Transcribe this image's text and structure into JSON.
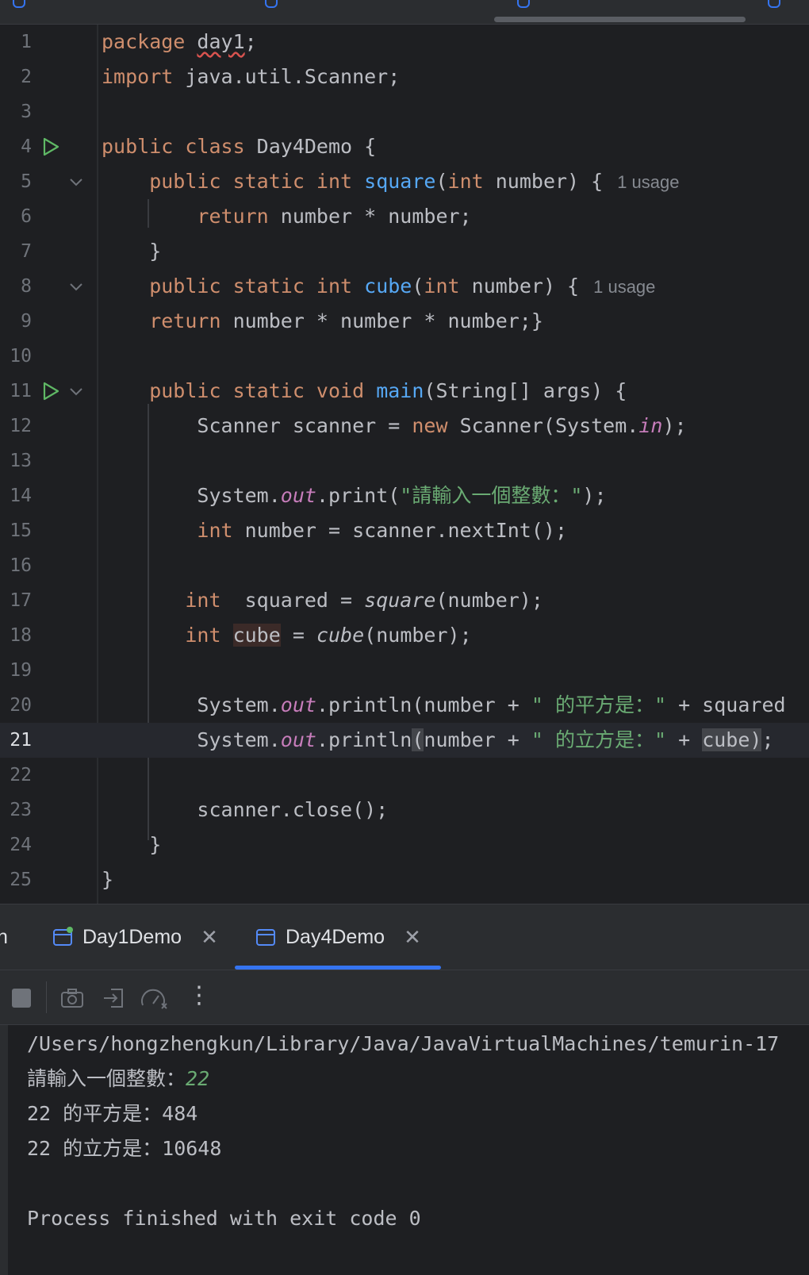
{
  "editor": {
    "lines": [
      {
        "num": "1",
        "tokens": [
          {
            "t": "package ",
            "c": "kw"
          },
          {
            "t": "day1",
            "c": "squiggle"
          },
          {
            "t": ";",
            "c": ""
          }
        ]
      },
      {
        "num": "2",
        "tokens": [
          {
            "t": "import ",
            "c": "kw"
          },
          {
            "t": "java.util.Scanner;",
            "c": ""
          }
        ]
      },
      {
        "num": "3",
        "tokens": []
      },
      {
        "num": "4",
        "tokens": [
          {
            "t": "public class ",
            "c": "kw"
          },
          {
            "t": "Day4Demo {",
            "c": ""
          }
        ]
      },
      {
        "num": "5",
        "tokens": [
          {
            "t": "    public static int ",
            "c": "kw"
          },
          {
            "t": "square",
            "c": "fn"
          },
          {
            "t": "(",
            "c": ""
          },
          {
            "t": "int ",
            "c": "kw"
          },
          {
            "t": "number) {",
            "c": ""
          },
          {
            "t": "1 usage",
            "c": "hint"
          }
        ]
      },
      {
        "num": "6",
        "tokens": [
          {
            "t": "        return ",
            "c": "kw"
          },
          {
            "t": "number * number;",
            "c": ""
          }
        ]
      },
      {
        "num": "7",
        "tokens": [
          {
            "t": "    }",
            "c": ""
          }
        ]
      },
      {
        "num": "8",
        "tokens": [
          {
            "t": "    public static int ",
            "c": "kw"
          },
          {
            "t": "cube",
            "c": "fn"
          },
          {
            "t": "(",
            "c": ""
          },
          {
            "t": "int ",
            "c": "kw"
          },
          {
            "t": "number) {",
            "c": ""
          },
          {
            "t": "1 usage",
            "c": "hint"
          }
        ]
      },
      {
        "num": "9",
        "tokens": [
          {
            "t": "    return ",
            "c": "kw"
          },
          {
            "t": "number * number * number;}",
            "c": ""
          }
        ]
      },
      {
        "num": "10",
        "tokens": []
      },
      {
        "num": "11",
        "tokens": [
          {
            "t": "    public static void ",
            "c": "kw"
          },
          {
            "t": "main",
            "c": "fn"
          },
          {
            "t": "(String[] args) {",
            "c": ""
          }
        ]
      },
      {
        "num": "12",
        "tokens": [
          {
            "t": "        Scanner scanner = ",
            "c": ""
          },
          {
            "t": "new ",
            "c": "kw"
          },
          {
            "t": "Scanner(System.",
            "c": ""
          },
          {
            "t": "in",
            "c": "fld"
          },
          {
            "t": ");",
            "c": ""
          }
        ]
      },
      {
        "num": "13",
        "tokens": []
      },
      {
        "num": "14",
        "tokens": [
          {
            "t": "        System.",
            "c": ""
          },
          {
            "t": "out",
            "c": "fld"
          },
          {
            "t": ".print(",
            "c": ""
          },
          {
            "t": "\"請輸入一個整數：\"",
            "c": "str"
          },
          {
            "t": ");",
            "c": ""
          }
        ]
      },
      {
        "num": "15",
        "tokens": [
          {
            "t": "        int ",
            "c": "kw"
          },
          {
            "t": "number = scanner.nextInt();",
            "c": ""
          }
        ]
      },
      {
        "num": "16",
        "tokens": []
      },
      {
        "num": "17",
        "tokens": [
          {
            "t": "       int  ",
            "c": "kw"
          },
          {
            "t": "squared = ",
            "c": ""
          },
          {
            "t": "square",
            "c": "it"
          },
          {
            "t": "(number);",
            "c": ""
          }
        ]
      },
      {
        "num": "18",
        "tokens": [
          {
            "t": "       int ",
            "c": "kw"
          },
          {
            "t": "cube",
            "c": "hl-var"
          },
          {
            "t": " = ",
            "c": ""
          },
          {
            "t": "cube",
            "c": "it"
          },
          {
            "t": "(number);",
            "c": ""
          }
        ]
      },
      {
        "num": "19",
        "tokens": []
      },
      {
        "num": "20",
        "tokens": [
          {
            "t": "        System.",
            "c": ""
          },
          {
            "t": "out",
            "c": "fld"
          },
          {
            "t": ".println(number + ",
            "c": ""
          },
          {
            "t": "\" 的平方是：\"",
            "c": "str"
          },
          {
            "t": " + squared",
            "c": ""
          }
        ]
      },
      {
        "num": "21",
        "tokens": [
          {
            "t": "        System.",
            "c": ""
          },
          {
            "t": "out",
            "c": "fld"
          },
          {
            "t": ".println",
            "c": ""
          },
          {
            "t": "(",
            "c": "hl-brace"
          },
          {
            "t": "number + ",
            "c": ""
          },
          {
            "t": "\" 的立方是：\"",
            "c": "str"
          },
          {
            "t": " + ",
            "c": ""
          },
          {
            "t": "cube",
            "c": "hl-brace"
          },
          {
            "t": ")",
            "c": "hl-brace"
          },
          {
            "t": ";",
            "c": ""
          }
        ]
      },
      {
        "num": "22",
        "tokens": []
      },
      {
        "num": "23",
        "tokens": [
          {
            "t": "        scanner.close();",
            "c": ""
          }
        ]
      },
      {
        "num": "24",
        "tokens": [
          {
            "t": "    }",
            "c": ""
          }
        ]
      },
      {
        "num": "25",
        "tokens": [
          {
            "t": "}",
            "c": ""
          }
        ]
      }
    ],
    "current_line": "21",
    "run_lines": [
      "4",
      "11"
    ],
    "fold_lines": [
      "5",
      "8",
      "11"
    ]
  },
  "run_panel": {
    "partial_left_label": "n",
    "tabs": [
      {
        "label": "Day1Demo",
        "close": "✕"
      },
      {
        "label": "Day4Demo",
        "close": "✕"
      }
    ],
    "active_tab": "Day4Demo",
    "toolbar_more": "⋮",
    "console": {
      "path_line": "/Users/hongzhengkun/Library/Java/JavaVirtualMachines/temurin-17",
      "prompt": "請輸入一個整數：",
      "input": "22",
      "square_line": "22 的平方是：484",
      "cube_line": "22 的立方是：10648",
      "exit_line": "Process finished with exit code 0"
    }
  },
  "colors": {
    "background": "#1e1f22",
    "keyword": "#cf8e6d",
    "function": "#56a8f5",
    "string": "#6aab73",
    "field": "#c77dbb",
    "accent": "#3574f0",
    "run_green": "#5fb865"
  }
}
